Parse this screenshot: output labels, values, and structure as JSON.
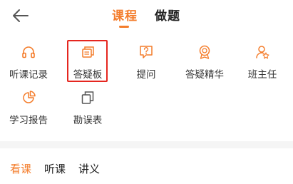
{
  "header": {
    "tabs": [
      {
        "label": "课程",
        "active": true
      },
      {
        "label": "做题",
        "active": false
      }
    ]
  },
  "grid": {
    "items": [
      {
        "label": "听课记录",
        "icon": "headphones-icon"
      },
      {
        "label": "答疑板",
        "icon": "layered-cards-icon",
        "highlighted": true
      },
      {
        "label": "提问",
        "icon": "question-chat-icon"
      },
      {
        "label": "答疑精华",
        "icon": "award-badge-icon"
      },
      {
        "label": "班主任",
        "icon": "teacher-user-icon"
      },
      {
        "label": "学习报告",
        "icon": "report-chart-icon"
      },
      {
        "label": "勘误表",
        "icon": "copy-pages-icon"
      }
    ]
  },
  "subtabs": [
    {
      "label": "看课",
      "active": true
    },
    {
      "label": "听课",
      "active": false
    },
    {
      "label": "讲义",
      "active": false
    }
  ],
  "colors": {
    "accent": "#F47D2C",
    "highlight_border": "#E5261F"
  }
}
